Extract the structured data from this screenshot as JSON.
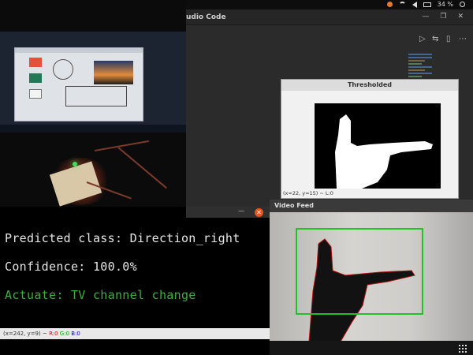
{
  "topbar": {
    "battery_text": "34 %"
  },
  "vscode": {
    "title_fragment": "udio Code"
  },
  "thresholded_window": {
    "title": "Thresholded",
    "status": "(x=22, y=15) ~ L:0"
  },
  "video_window": {
    "title": "Video Feed"
  },
  "console_window": {
    "lines": {
      "predicted": "Predicted class: Direction_right",
      "confidence": "Confidence: 100.0%",
      "actuate": "Actuate: TV channel change"
    },
    "status_prefix": "(x=242, y=9) ~",
    "status_r": "R:0",
    "status_g": "G:0",
    "status_b": "B:0",
    "colors": {
      "text": "#e6e6e6",
      "actuate": "#3fae3f"
    }
  },
  "icons": [
    "minimize-icon",
    "close-icon",
    "grid-icon",
    "battery-icon",
    "wifi-icon",
    "volume-icon",
    "power-icon"
  ]
}
